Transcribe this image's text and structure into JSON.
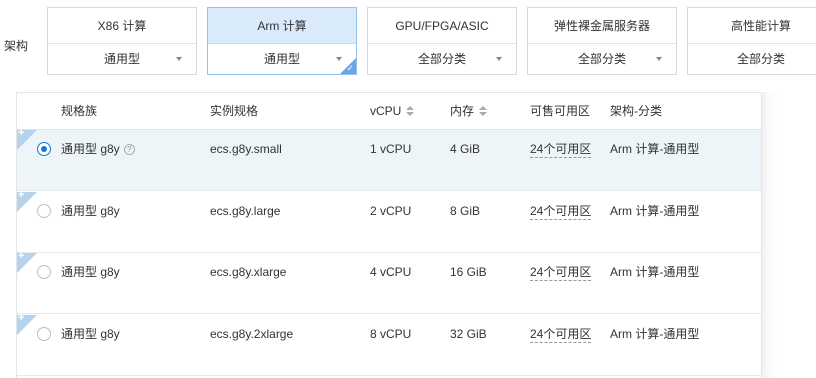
{
  "arch": {
    "label": "架构",
    "options": [
      {
        "title": "X86 计算",
        "sub": "通用型"
      },
      {
        "title": "Arm 计算",
        "sub": "通用型"
      },
      {
        "title": "GPU/FPGA/ASIC",
        "sub": "全部分类"
      },
      {
        "title": "弹性裸金属服务器",
        "sub": "全部分类"
      },
      {
        "title": "高性能计算",
        "sub": "全部分类"
      }
    ],
    "selected_index": 1
  },
  "table": {
    "headers": {
      "family": "规格族",
      "spec": "实例规格",
      "vcpu": "vCPU",
      "memory": "内存",
      "zones": "可售可用区",
      "arch": "架构-分类"
    },
    "rows": [
      {
        "family": "通用型 g8y",
        "spec": "ecs.g8y.small",
        "vcpu": "1 vCPU",
        "memory": "4 GiB",
        "zones": "24个可用区",
        "arch": "Arm 计算-通用型",
        "selected": true
      },
      {
        "family": "通用型 g8y",
        "spec": "ecs.g8y.large",
        "vcpu": "2 vCPU",
        "memory": "8 GiB",
        "zones": "24个可用区",
        "arch": "Arm 计算-通用型",
        "selected": false
      },
      {
        "family": "通用型 g8y",
        "spec": "ecs.g8y.xlarge",
        "vcpu": "4 vCPU",
        "memory": "16 GiB",
        "zones": "24个可用区",
        "arch": "Arm 计算-通用型",
        "selected": false
      },
      {
        "family": "通用型 g8y",
        "spec": "ecs.g8y.2xlarge",
        "vcpu": "8 vCPU",
        "memory": "32 GiB",
        "zones": "24个可用区",
        "arch": "Arm 计算-通用型",
        "selected": false
      }
    ]
  },
  "icons": {
    "help": "?",
    "check": "✓",
    "plus": "+"
  },
  "colors": {
    "accent": "#1677d2",
    "selected_card_bg": "#d9eafb",
    "selected_row_bg": "#eef5f9",
    "corner_marker": "#b6d3ee"
  }
}
